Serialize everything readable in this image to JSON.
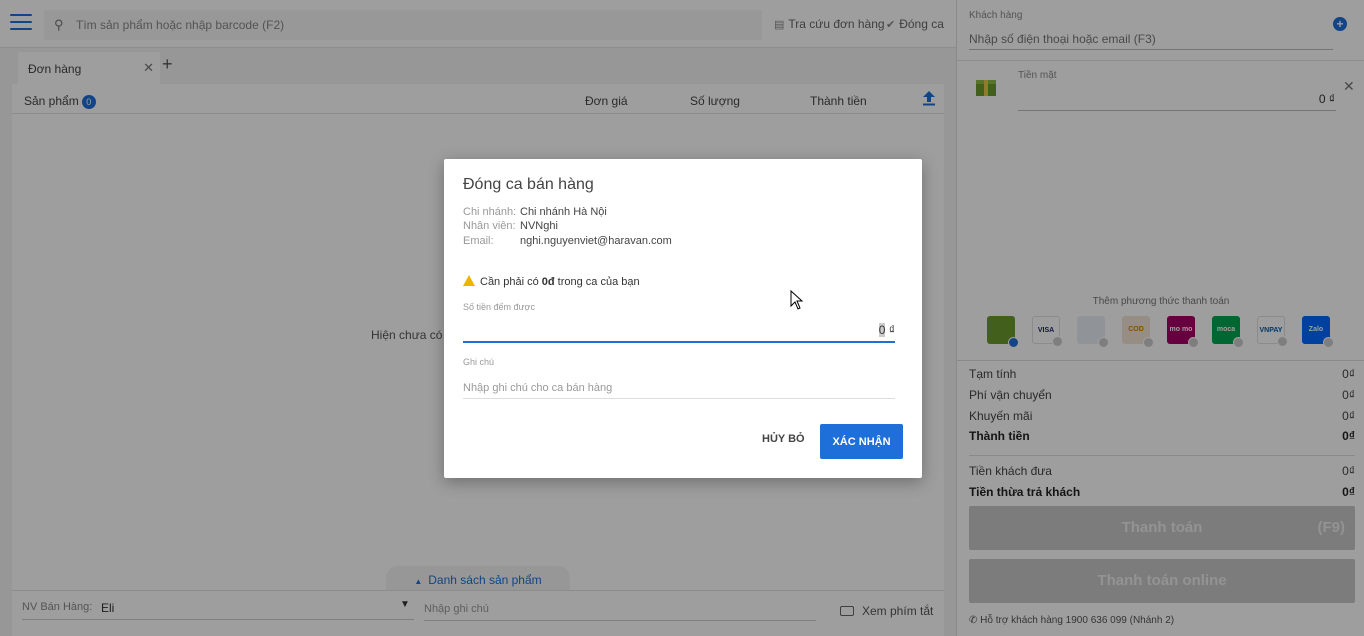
{
  "topbar": {
    "search_placeholder": "Tìm sản phẩm hoặc nhập barcode (F2)",
    "lookup_label": "Tra cứu đơn hàng",
    "close_shift_label": "Đóng ca"
  },
  "tabs": [
    {
      "label": "Đơn hàng"
    }
  ],
  "grid": {
    "product_col": "Sản phẩm",
    "product_count": "0",
    "price_col": "Đơn giá",
    "qty_col": "Số lượng",
    "total_col": "Thành tiền",
    "empty_text": "Hiện chưa có s"
  },
  "bottom": {
    "product_list_label": "Danh sách sản phẩm",
    "staff_label": "NV Bán Hàng:",
    "staff_value": "Eli",
    "note_placeholder": "Nhập ghi chú",
    "shortcut_label": "Xem phím tắt"
  },
  "right": {
    "customer_label": "Khách hàng",
    "customer_placeholder": "Nhập số điện thoại hoặc email (F3)",
    "cash_label": "Tiền mặt",
    "cash_value": "0 ₫",
    "methods_label": "Thêm phương thức thanh toán",
    "methods": [
      {
        "name": "cash",
        "text": "",
        "bg": "#6b9a2e",
        "fg": "#fff",
        "selected": true
      },
      {
        "name": "visa",
        "text": "VISA",
        "bg": "#ffffff",
        "fg": "#1a1f71",
        "selected": false
      },
      {
        "name": "bank-transfer",
        "text": "",
        "bg": "#e9eef5",
        "fg": "#2a5caa",
        "selected": false
      },
      {
        "name": "cod",
        "text": "COD",
        "bg": "#f3e6d6",
        "fg": "#e07b00",
        "selected": false
      },
      {
        "name": "momo",
        "text": "mo mo",
        "bg": "#a50064",
        "fg": "#fff",
        "selected": false
      },
      {
        "name": "moca",
        "text": "moca",
        "bg": "#00a651",
        "fg": "#fff",
        "selected": false
      },
      {
        "name": "vnpay",
        "text": "VNPAY",
        "bg": "#ffffff",
        "fg": "#005baa",
        "selected": false
      },
      {
        "name": "zalopay",
        "text": "Zalo",
        "bg": "#0068ff",
        "fg": "#fff",
        "selected": false
      }
    ],
    "summary": [
      {
        "label": "Tạm tính",
        "value": "0₫",
        "bold": false
      },
      {
        "label": "Phí vận chuyển",
        "value": "0₫",
        "bold": false
      },
      {
        "label": "Khuyến mãi",
        "value": "0₫",
        "bold": false
      },
      {
        "label": "Thành tiền",
        "value": "0₫",
        "bold": true
      }
    ],
    "paid": [
      {
        "label": "Tiền khách đưa",
        "value": "0₫",
        "bold": false
      },
      {
        "label": "Tiền thừa trả khách",
        "value": "0₫",
        "bold": true
      }
    ],
    "pay_button": "Thanh toán",
    "pay_shortcut": "(F9)",
    "pay_online_button": "Thanh toán online",
    "support_text": "Hỗ trợ khách hàng 1900 636 099 (Nhánh 2)"
  },
  "modal": {
    "title": "Đóng ca bán hàng",
    "branch_label": "Chi nhánh:",
    "branch_value": "Chi nhánh Hà Nội",
    "staff_label": "Nhân viên:",
    "staff_value": "NVNghi",
    "email_label": "Email:",
    "email_value": "nghi.nguyenviet@haravan.com",
    "warning_pre": "Cần phải có ",
    "warning_amount": "0đ",
    "warning_post": " trong ca của bạn",
    "amount_label": "Số tiền đếm được",
    "amount_value": "0",
    "amount_unit": "₫",
    "note_label": "Ghi chú",
    "note_placeholder": "Nhập ghi chú cho ca bán hàng",
    "cancel_label": "HỦY BỎ",
    "confirm_label": "XÁC NHẬN"
  },
  "colors": {
    "accent": "#1e6fd9",
    "warning": "#f0b400",
    "disabled_button": "#c8c8c8"
  }
}
